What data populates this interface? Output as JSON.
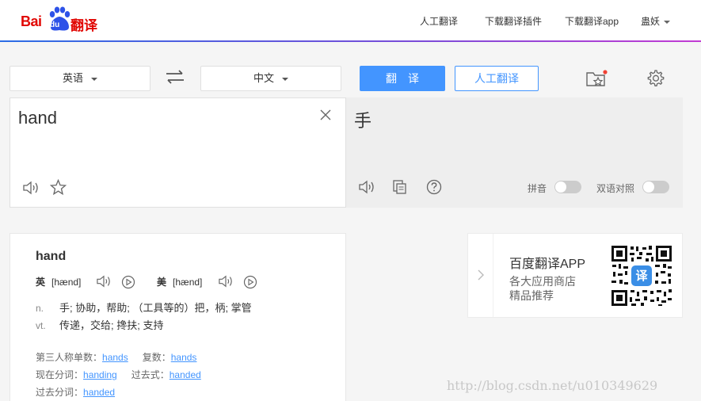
{
  "header": {
    "logo": {
      "bai": "Bai",
      "du": "du",
      "fanyi": "翻译"
    },
    "nav": [
      {
        "label": "人工翻译"
      },
      {
        "label": "下载翻译插件"
      },
      {
        "label": "下载翻译app"
      },
      {
        "label": "蛊妖"
      }
    ]
  },
  "toolbar": {
    "source_lang": "英语",
    "target_lang": "中文",
    "translate_label": "翻译",
    "human_label": "人工翻译"
  },
  "source": {
    "text": "hand"
  },
  "target": {
    "text": "手",
    "pinyin_label": "拼音",
    "bilingual_label": "双语对照"
  },
  "dictionary": {
    "word": "hand",
    "uk_label": "英",
    "uk_phonetic": "[hænd]",
    "us_label": "美",
    "us_phonetic": "[hænd]",
    "definitions": [
      {
        "pos": "n.",
        "text": "手; 协助，帮助; （工具等的）把，柄; 掌管"
      },
      {
        "pos": "vt.",
        "text": "传递，交给; 搀扶; 支持"
      }
    ],
    "forms": {
      "third_person_label": "第三人称单数：",
      "third_person": "hands",
      "plural_label": "复数：",
      "plural": "hands",
      "present_participle_label": "现在分词：",
      "present_participle": "handing",
      "past_tense_label": "过去式：",
      "past_tense": "handed",
      "past_participle_label": "过去分词：",
      "past_participle": "handed"
    }
  },
  "app_promo": {
    "title": "百度翻译APP",
    "line1": "各大应用商店",
    "line2": "精品推荐",
    "qr_badge": "译"
  },
  "watermark": "http://blog.csdn.net/u010349629",
  "colors": {
    "accent": "#4395ff",
    "brand_red": "#e10602",
    "paw_blue": "#2d52e8"
  },
  "icons": [
    "swap-icon",
    "favorites-icon",
    "settings-icon",
    "close-icon",
    "speaker-icon",
    "star-icon",
    "copy-icon",
    "help-icon",
    "play-icon",
    "chevron-right-icon"
  ]
}
